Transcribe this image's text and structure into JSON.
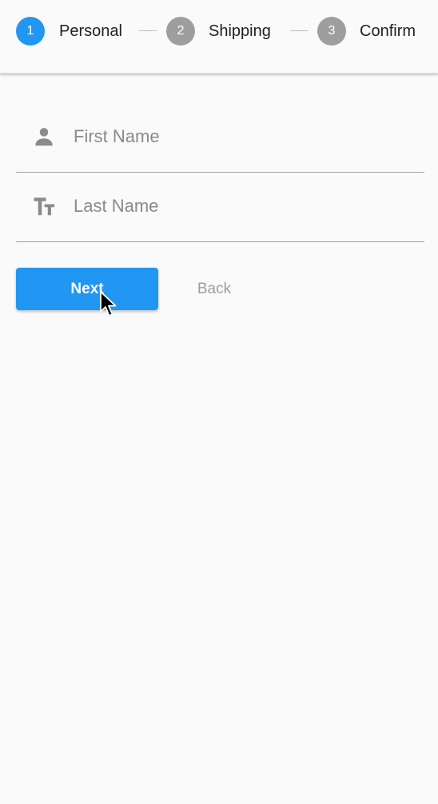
{
  "stepper": {
    "steps": [
      {
        "number": "1",
        "label": "Personal",
        "state": "active"
      },
      {
        "number": "2",
        "label": "Shipping",
        "state": "inactive"
      },
      {
        "number": "3",
        "label": "Confirm",
        "state": "inactive"
      }
    ]
  },
  "form": {
    "first_name": {
      "placeholder": "First Name",
      "value": "",
      "icon": "person-icon"
    },
    "last_name": {
      "placeholder": "Last Name",
      "value": "",
      "icon": "text-fields-icon"
    }
  },
  "actions": {
    "next_label": "Next",
    "back_label": "Back"
  },
  "colors": {
    "accent": "#2196f3",
    "inactive": "#9e9e9e",
    "background": "#fafafa",
    "text": "#212121"
  }
}
